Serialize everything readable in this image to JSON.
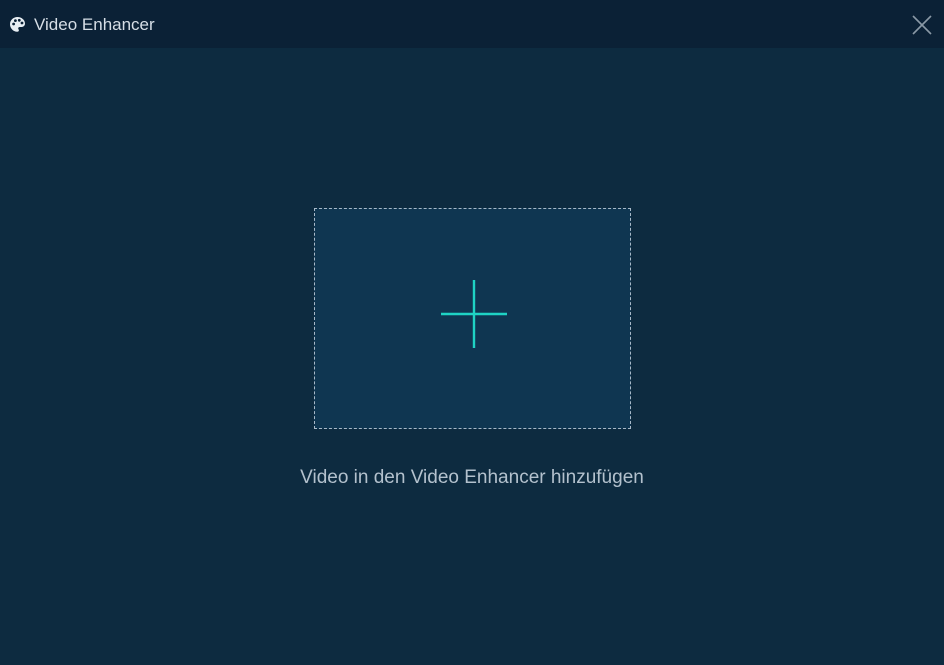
{
  "window": {
    "title": "Video Enhancer",
    "app_icon": "palette-icon",
    "close_icon": "close-icon"
  },
  "drop_zone": {
    "icon": "plus-icon",
    "hint": "Video in den Video Enhancer hinzufügen"
  },
  "colors": {
    "titlebar_bg": "#0b2136",
    "body_bg": "#0d2b40",
    "drop_zone_bg": "#0f3651",
    "accent": "#1fd3c4",
    "text": "#b3c1cd"
  }
}
